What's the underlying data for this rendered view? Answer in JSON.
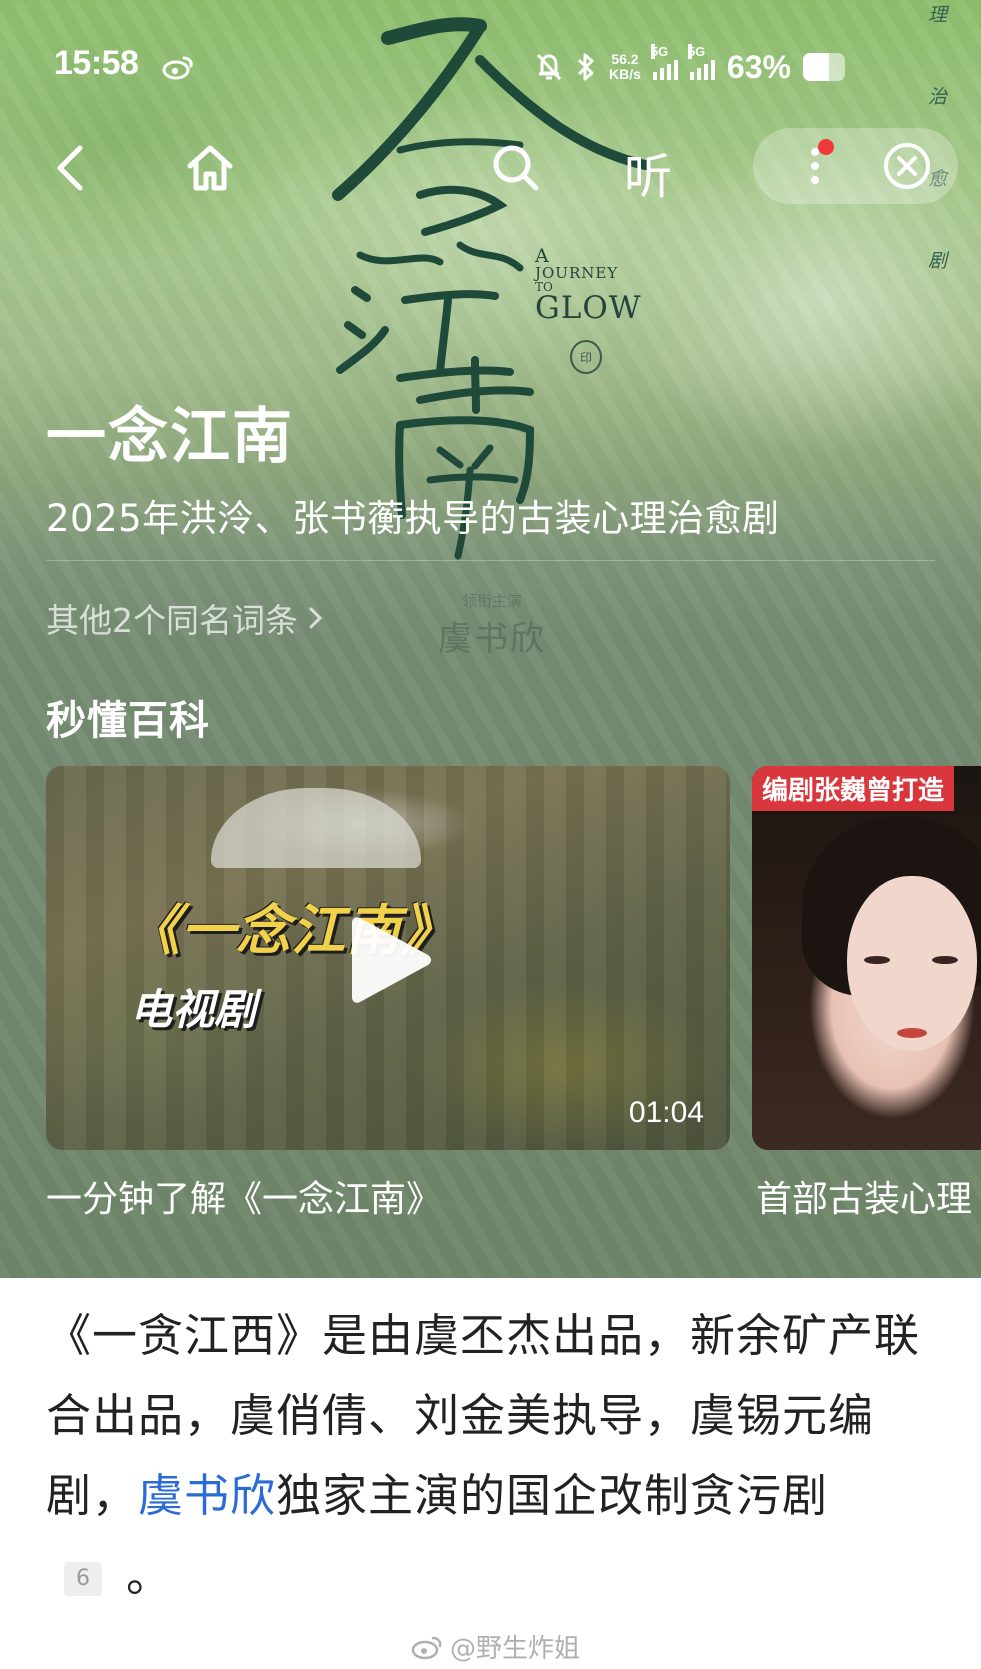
{
  "status_bar": {
    "time": "15:58",
    "weibo_icon": "weibo-icon",
    "net_speed_value": "56.2",
    "net_speed_unit": "KB/s",
    "signal_1_label": "5G",
    "signal_2_label": "5G",
    "battery_percent": "63%",
    "battery_level": 0.63
  },
  "nav": {
    "back_icon": "chevron-left-icon",
    "home_icon": "home-icon",
    "search_icon": "search-icon",
    "listen_label": "听",
    "more_icon": "more-vertical-icon",
    "close_icon": "close-circle-icon",
    "notification_dot_color": "#f03a3a"
  },
  "poster": {
    "title_art": "一念江南",
    "english_a": "A",
    "english_journey": "JOURNEY",
    "english_to": "TO",
    "english_glow": "GLOW",
    "seal": "印",
    "vertical_chars": [
      "理",
      "治",
      "愈",
      "剧"
    ],
    "credit_small": "领衔主演",
    "credit_name": "虞书欣"
  },
  "entry": {
    "title": "一念江南",
    "subtitle": "2025年洪泠、张书蘅执导的古装心理治愈剧",
    "other_entries": "其他2个同名词条"
  },
  "section": {
    "title": "秒懂百科"
  },
  "videos": [
    {
      "title_art": "《一念江南》",
      "subtitle_art": "电视剧",
      "duration": "01:04",
      "caption": "一分钟了解《一念江南》"
    },
    {
      "tag": "编剧张巍曾打造",
      "caption": "首部古装心理"
    }
  ],
  "description": {
    "part1": "《一贪江西》是由虞丕杰出品，新余矿产联合出品，虞俏倩、刘金美执导，虞锡元编剧，",
    "link": "虞书欣",
    "part2": "独家主演的国企改制贪污剧",
    "citation": "6",
    "end": "。"
  },
  "watermark": "@野生炸姐",
  "colors": {
    "link": "#2b6bd6",
    "hero_green": "#6f8669",
    "poster_ink": "#1f4a3a"
  }
}
